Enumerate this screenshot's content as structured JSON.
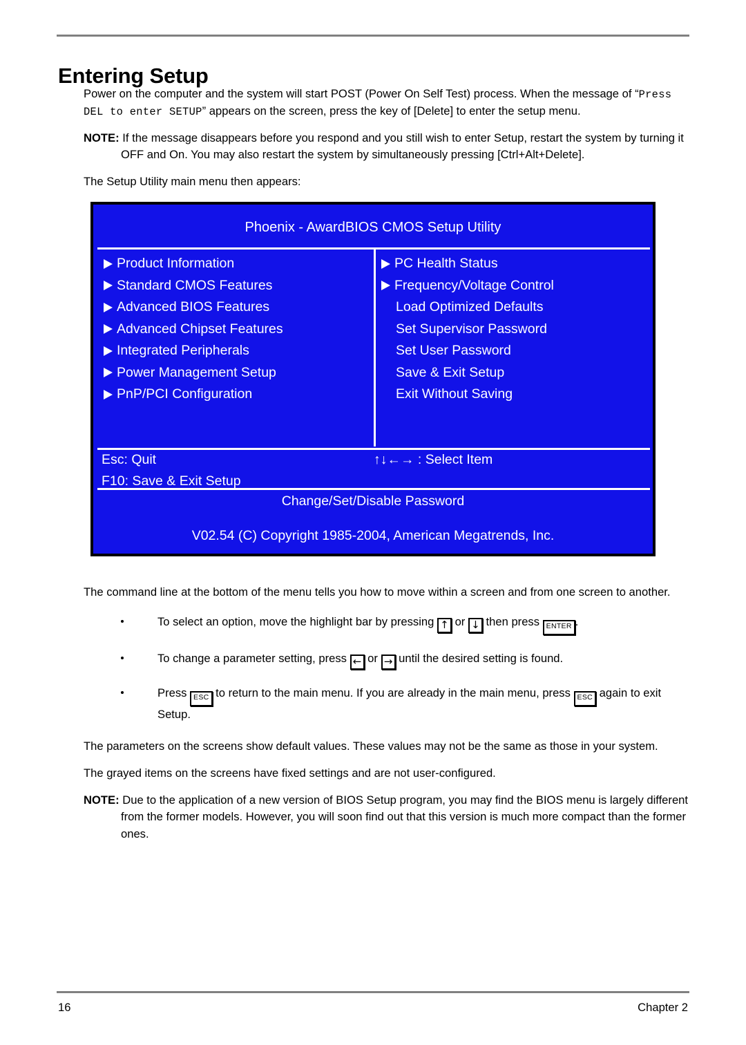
{
  "page": {
    "heading": "Entering Setup",
    "footer_page_number": "16",
    "footer_chapter": "Chapter 2"
  },
  "intro": {
    "para1_before_mono": "Power on the computer and the system will start POST (Power On Self Test) process. When the message of “",
    "para1_mono": "Press DEL to enter SETUP",
    "para1_after_mono": "” appears on the screen, press the key of [Delete] to enter the setup menu.",
    "note_label": "NOTE:",
    "note_text": "If the message disappears before you respond and you still wish to enter Setup, restart the system by turning it OFF and On. You may also restart the system by simultaneously pressing [Ctrl+Alt+Delete].",
    "para2": "The Setup Utility main menu then appears:"
  },
  "bios": {
    "title": "Phoenix - AwardBIOS CMOS Setup Utility",
    "background_color": "#1212e8",
    "text_color": "#ffffff",
    "menu_left": [
      {
        "label": "Product Information",
        "arrow": true
      },
      {
        "label": "Standard CMOS Features",
        "arrow": true
      },
      {
        "label": "Advanced BIOS Features",
        "arrow": true
      },
      {
        "label": "Advanced Chipset Features",
        "arrow": true
      },
      {
        "label": "Integrated Peripherals",
        "arrow": true
      },
      {
        "label": "Power Management Setup",
        "arrow": true
      },
      {
        "label": "PnP/PCI Configuration",
        "arrow": true
      }
    ],
    "menu_right": [
      {
        "label": "PC Health Status",
        "arrow": true
      },
      {
        "label": "Frequency/Voltage Control",
        "arrow": true
      },
      {
        "label": "Load Optimized Defaults",
        "arrow": false
      },
      {
        "label": "Set Supervisor Password",
        "arrow": false
      },
      {
        "label": "Set User Password",
        "arrow": false
      },
      {
        "label": "Save & Exit Setup",
        "arrow": false
      },
      {
        "label": "Exit Without Saving",
        "arrow": false
      }
    ],
    "key_esc": "Esc: Quit",
    "key_select": "↑↓←→ : Select Item",
    "key_f10": "F10:  Save & Exit Setup",
    "help_line": "Change/Set/Disable Password",
    "copyright": "V02.54 (C) Copyright 1985-2004, American Megatrends, Inc."
  },
  "lower": {
    "command_line_para": "The command line at the bottom of the menu tells you how to move within a screen and from one screen to another.",
    "bullet1": {
      "part1": "To select an option, move the highlight bar by pressing ",
      "key_up": "↑",
      "part2": " or ",
      "key_down": "↓",
      "part3": " then press ",
      "key_enter": "ENTER",
      "part4": "."
    },
    "bullet2": {
      "part1": "To change a parameter setting, press ",
      "key_left": "←",
      "part2": " or ",
      "key_right": "→",
      "part3": " until the desired setting is found."
    },
    "bullet3": {
      "part1": "Press ",
      "key_esc_1": "ESC",
      "part2": " to return to the main menu. If you are already in the main menu, press ",
      "key_esc_2": "ESC",
      "part3": " again to exit Setup."
    },
    "params_para": "The parameters on the screens show default values. These values may not be the same as those in your system.",
    "grayed_para": "The grayed items on the screens have fixed settings and are not user-configured.",
    "note_label": "NOTE:",
    "note_text": "Due to the application of a new version of BIOS Setup program, you may find the BIOS menu is largely different from the former models. However, you will soon find out that this version is much more compact than the former ones."
  }
}
